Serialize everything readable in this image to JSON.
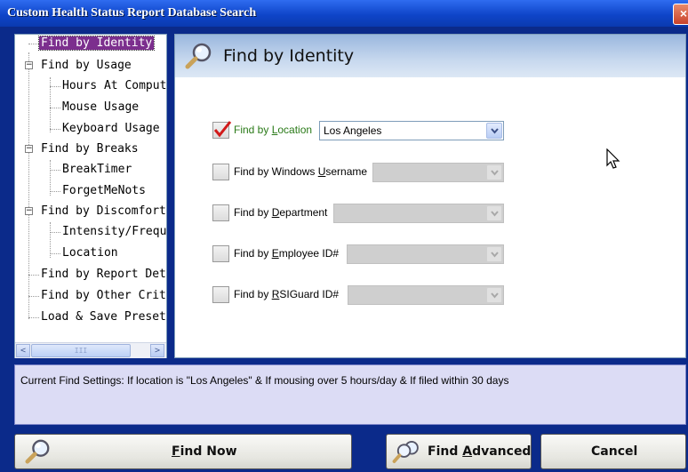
{
  "window": {
    "title": "Custom Health Status Report Database Search",
    "close_label": "×"
  },
  "tree": {
    "items": [
      {
        "label": "Find by Identity",
        "selected": true
      },
      {
        "label": "Find by Usage"
      },
      {
        "label": "Hours At Comput"
      },
      {
        "label": "Mouse Usage"
      },
      {
        "label": "Keyboard Usage"
      },
      {
        "label": "Find by Breaks"
      },
      {
        "label": "BreakTimer"
      },
      {
        "label": "ForgetMeNots"
      },
      {
        "label": "Find by Discomfort"
      },
      {
        "label": "Intensity/Freque"
      },
      {
        "label": "Location"
      },
      {
        "label": "Find by Report Detai"
      },
      {
        "label": "Find by Other Criter"
      },
      {
        "label": "Load & Save Presets"
      }
    ],
    "expander_symbol": "−",
    "scroll_left": "<",
    "scroll_right": ">",
    "scroll_grip": "III"
  },
  "panel": {
    "title": "Find by Identity",
    "rows": [
      {
        "pre": "Find by ",
        "key": "L",
        "post": "ocation",
        "checked": true,
        "value": "Los Angeles"
      },
      {
        "pre": "Find by Windows ",
        "key": "U",
        "post": "sername",
        "checked": false,
        "value": ""
      },
      {
        "pre": "Find by ",
        "key": "D",
        "post": "epartment",
        "checked": false,
        "value": ""
      },
      {
        "pre": "Find by ",
        "key": "E",
        "post": "mployee ID#",
        "checked": false,
        "value": ""
      },
      {
        "pre": "Find by ",
        "key": "R",
        "post": "SIGuard ID#",
        "checked": false,
        "value": ""
      }
    ]
  },
  "status": {
    "text": "Current Find Settings: If location is \"Los Angeles\" & If mousing over 5 hours/day & If filed within 30 days"
  },
  "buttons": {
    "find_now": {
      "key": "F",
      "rest": "ind Now"
    },
    "find_advanced": {
      "pre": "Find ",
      "key": "A",
      "rest": "dvanced"
    },
    "cancel": "Cancel"
  },
  "colors": {
    "selection": "#7c2f8e",
    "title_bar": "#0f45c9",
    "status_bg": "#dcdcf5",
    "check_red": "#d11a1a"
  }
}
